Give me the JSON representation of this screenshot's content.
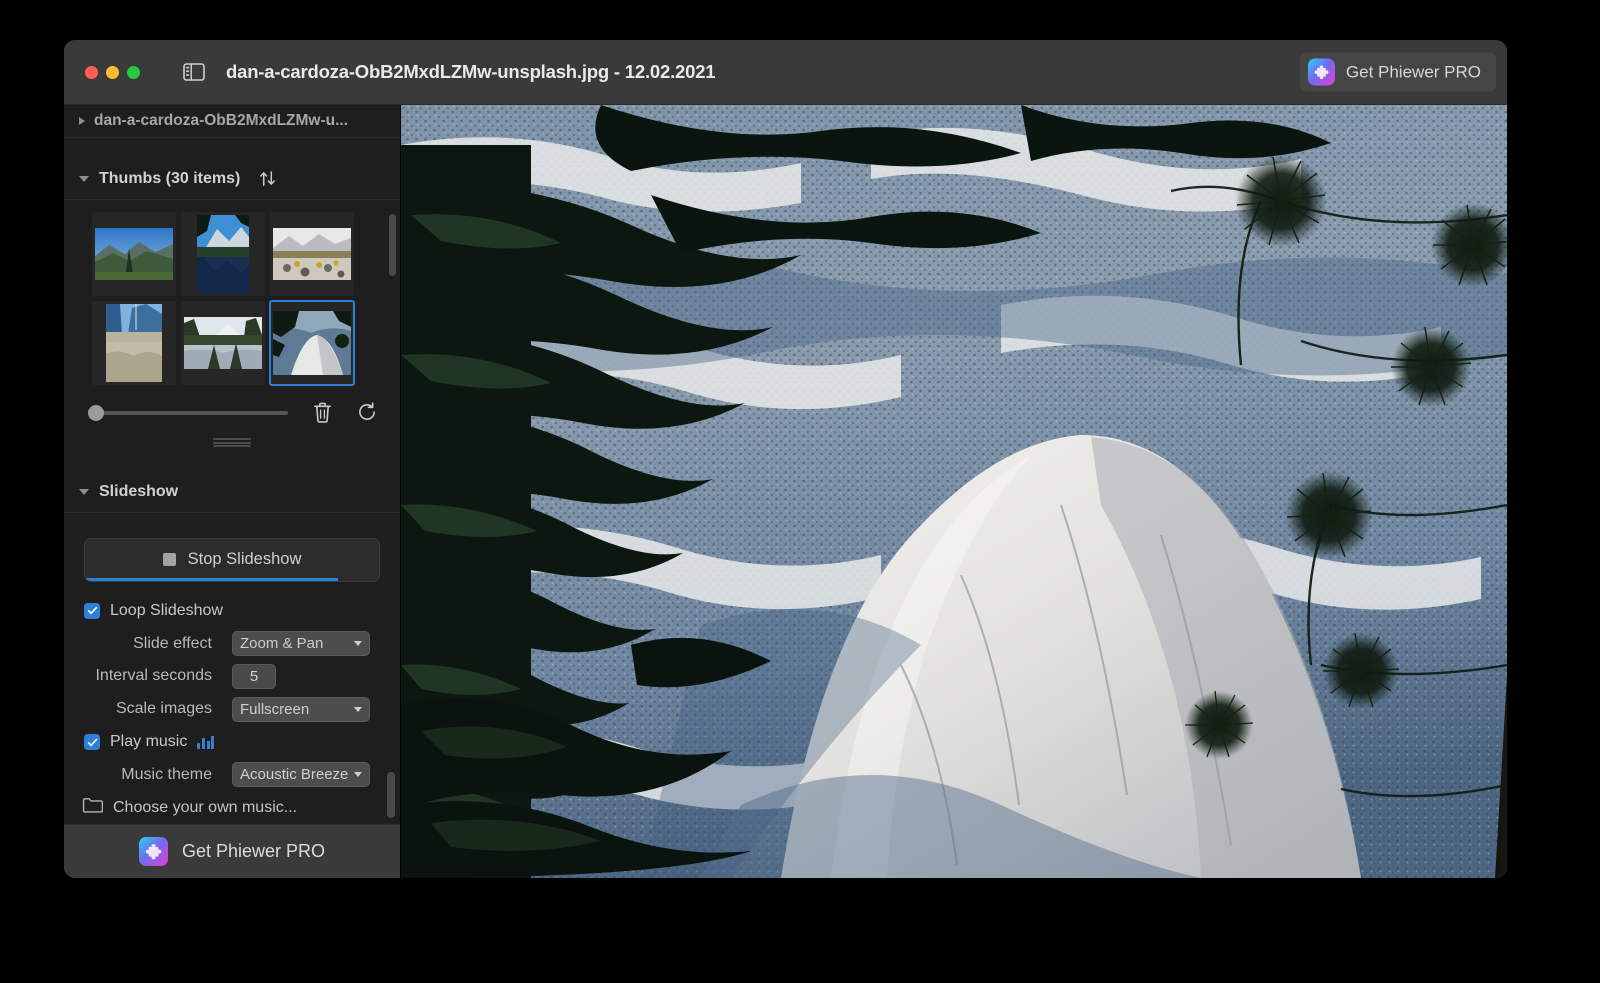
{
  "window": {
    "title": "dan-a-cardoza-ObB2MxdLZMw-unsplash.jpg - 12.02.2021",
    "traffic_lights": [
      "close",
      "minimize",
      "zoom"
    ],
    "sidebar_toggle_icon": "sidebar-toggle-icon",
    "pro_button": {
      "label": "Get Phiewer PRO",
      "icon": "puzzle-piece-icon"
    },
    "accent_color": "#2f7fd6",
    "background_color": "#1e1e1e",
    "titlebar_color": "#3a3a3a"
  },
  "sidebar": {
    "path": {
      "label": "dan-a-cardoza-ObB2MxdLZMw-u...",
      "disclosure": "triangle-right-icon"
    },
    "thumbs": {
      "title": "Thumbs (30 items)",
      "disclosure": "triangle-down-icon",
      "sort_icon": "sort-arrows-icon",
      "item_count": 30,
      "items": [
        {
          "name": "thumb-1",
          "orientation": "landscape",
          "selected": false
        },
        {
          "name": "thumb-2",
          "orientation": "portrait",
          "selected": false
        },
        {
          "name": "thumb-3",
          "orientation": "landscape",
          "selected": false
        },
        {
          "name": "thumb-4",
          "orientation": "portrait",
          "selected": false
        },
        {
          "name": "thumb-5",
          "orientation": "landscape",
          "selected": false
        },
        {
          "name": "thumb-6",
          "orientation": "landscape",
          "selected": true
        }
      ],
      "size_slider": {
        "value": 0,
        "min": 0,
        "max": 100
      },
      "delete_icon": "trash-icon",
      "rotate_icon": "rotate-cw-icon",
      "resize_grip": "resize-grip-icon"
    },
    "slideshow": {
      "title": "Slideshow",
      "disclosure": "triangle-down-icon",
      "stop_button": {
        "label": "Stop Slideshow",
        "icon": "stop-square-icon",
        "progress_percent": 86
      },
      "loop": {
        "label": "Loop Slideshow",
        "checked": true
      },
      "slide_effect": {
        "label": "Slide effect",
        "value": "Zoom & Pan"
      },
      "interval_seconds": {
        "label": "Interval seconds",
        "value": "5"
      },
      "scale_images": {
        "label": "Scale images",
        "value": "Fullscreen"
      },
      "play_music": {
        "label": "Play music",
        "checked": true,
        "icon": "equalizer-icon"
      },
      "music_theme": {
        "label": "Music theme",
        "value": "Acoustic Breeze"
      },
      "choose_music": {
        "label": "Choose your own music...",
        "icon": "folder-icon"
      }
    },
    "footer_pro": {
      "label": "Get Phiewer PRO",
      "icon": "puzzle-piece-icon"
    }
  },
  "viewer": {
    "alt": "Yosemite granite dome framed by dark pine branches, snow patches on forested slope"
  }
}
